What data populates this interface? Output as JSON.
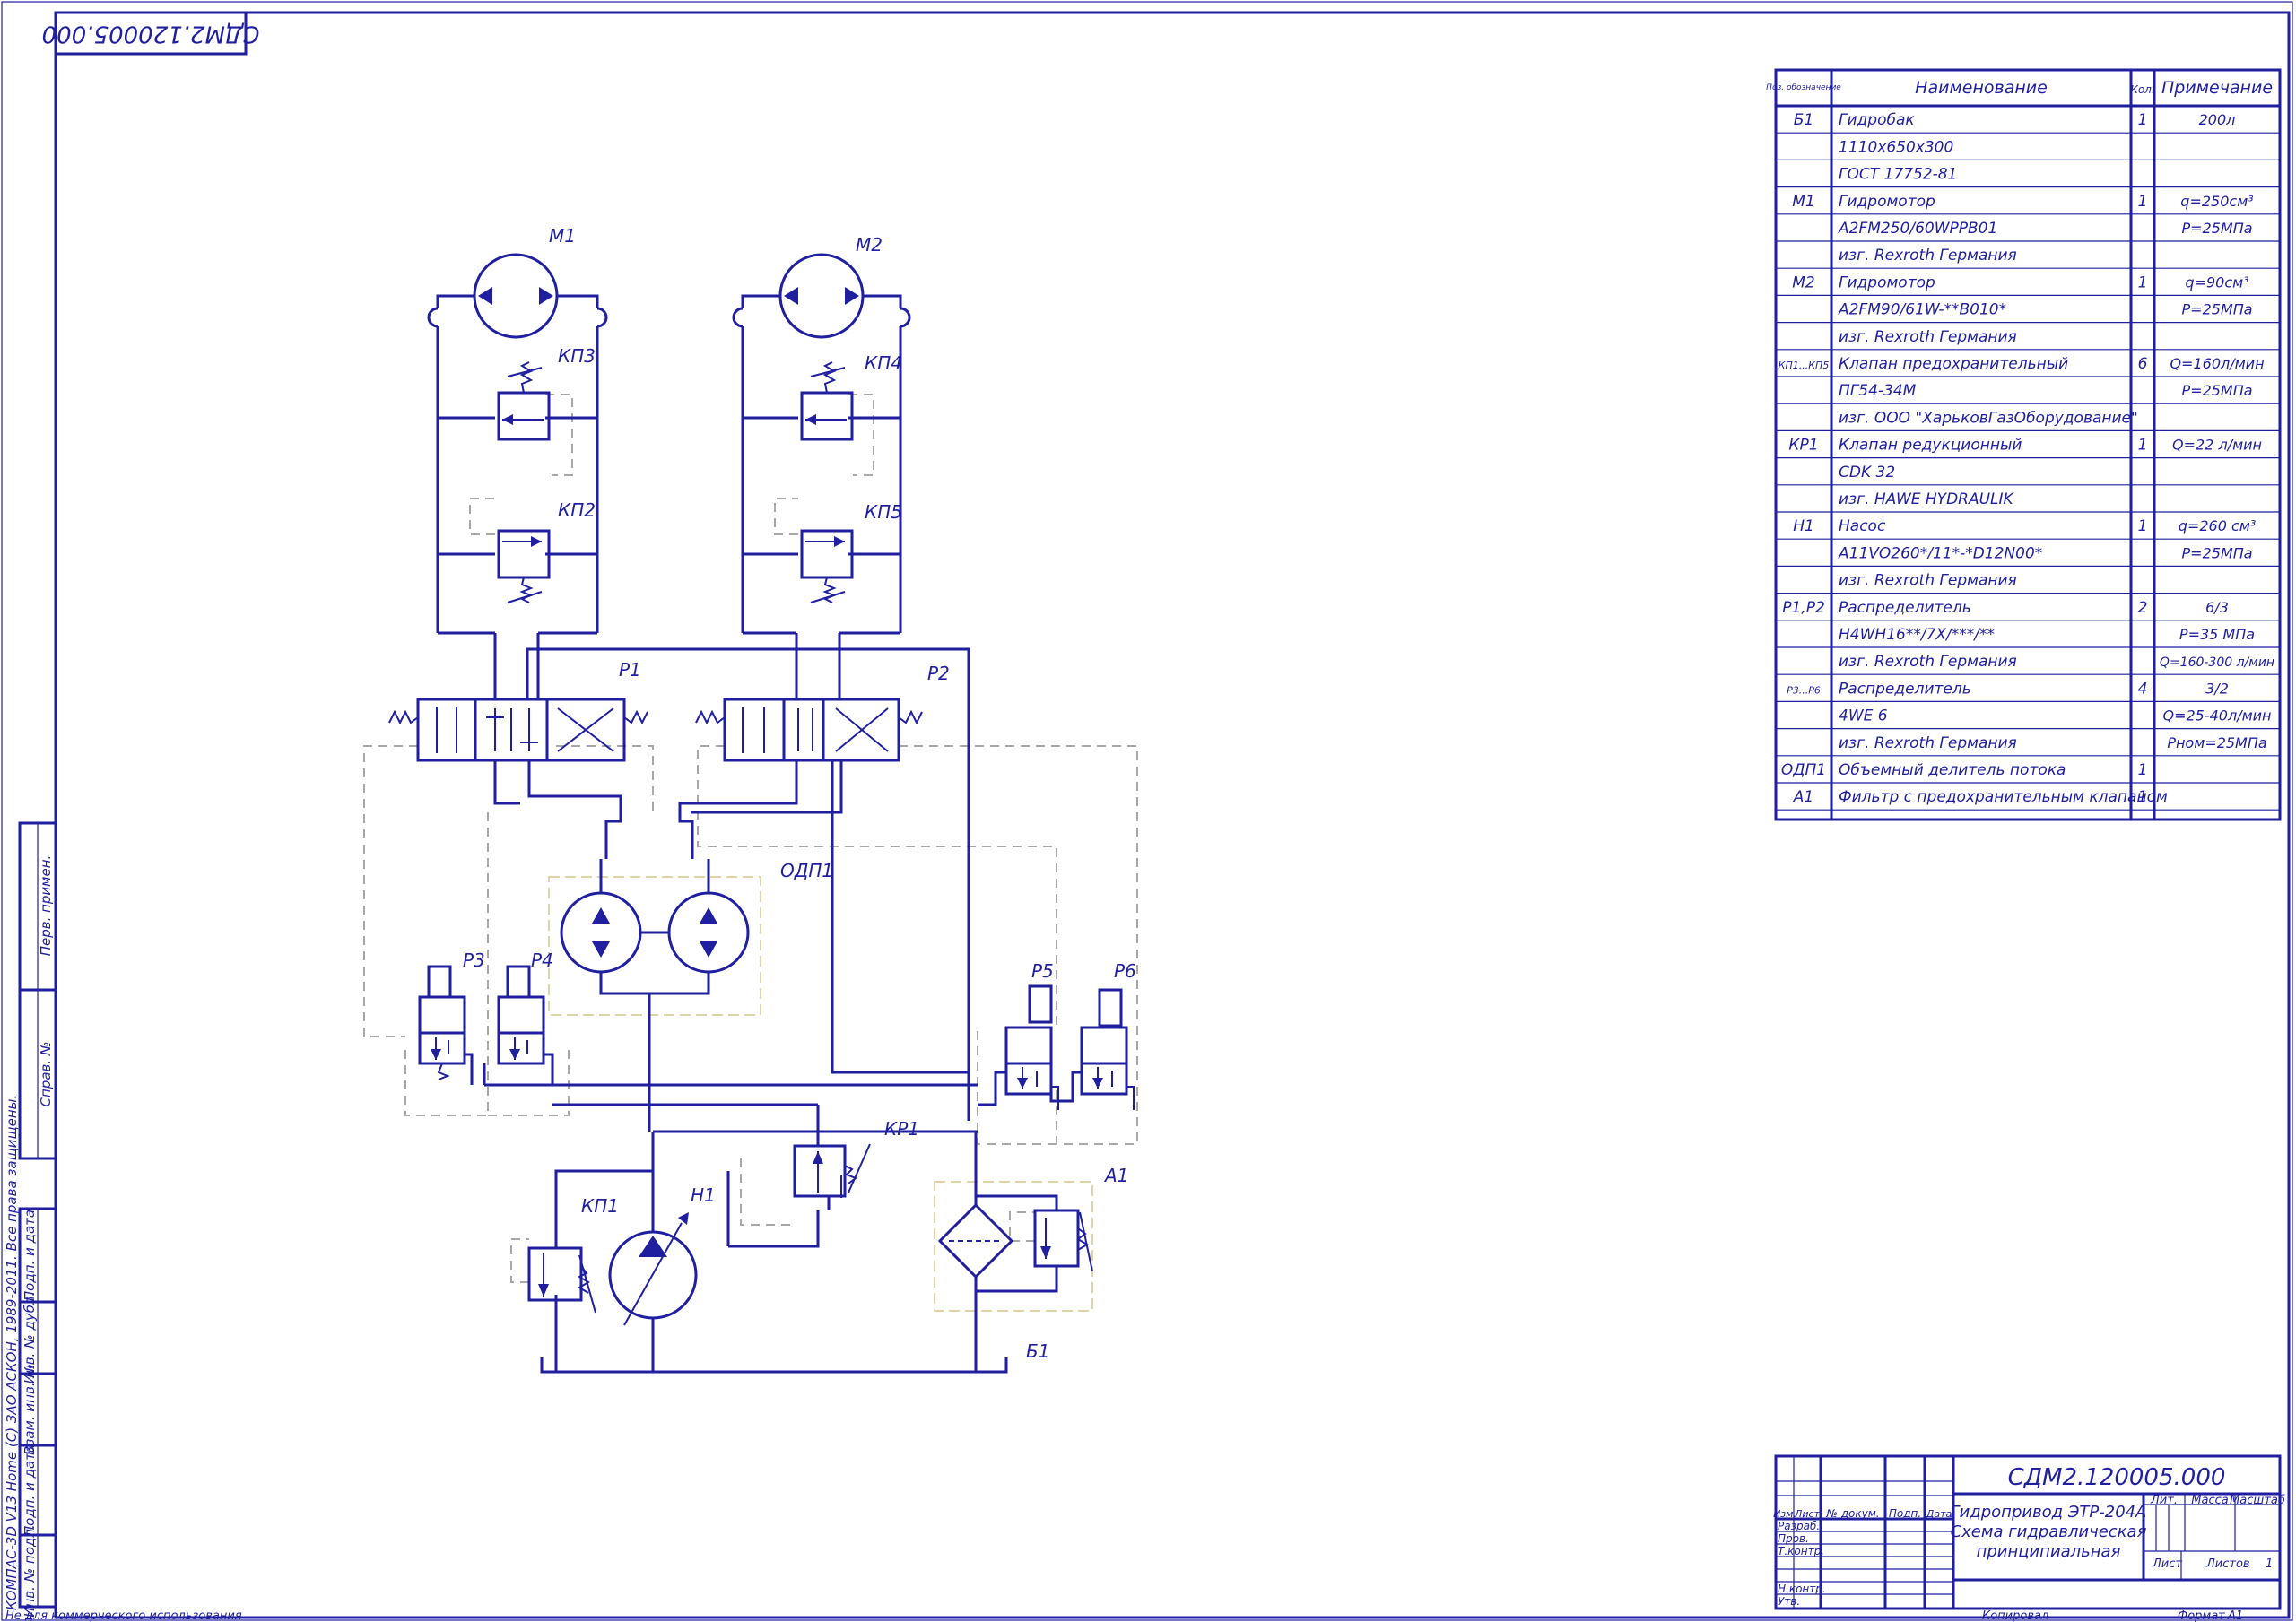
{
  "colors": {
    "ink": "#1f1fa0",
    "pilot": "#a8a8a8",
    "module_outline": "#e2d3a6",
    "paper": "#ffffff"
  },
  "corner_stamp": "СДМ2.120005.000",
  "diagram_labels": {
    "m1": "М1",
    "m2": "М2",
    "kp1": "КП1",
    "kp2": "КП2",
    "kp3": "КП3",
    "kp4": "КП4",
    "kp5": "КП5",
    "kr1": "КР1",
    "r1": "Р1",
    "r2": "Р2",
    "r3": "Р3",
    "r4": "Р4",
    "r5": "Р5",
    "r6": "Р6",
    "odp1": "ОДП1",
    "n1": "Н1",
    "a1": "А1",
    "b1": "Б1"
  },
  "parts_list": {
    "headers": {
      "pos": "Поз. обозначение",
      "name": "Наименование",
      "qty": "Кол.",
      "note": "Примечание"
    },
    "rows": [
      {
        "pos": "Б1",
        "name": "Гидробак",
        "qty": "1",
        "note": "200л"
      },
      {
        "pos": "",
        "name": "1110х650х300",
        "qty": "",
        "note": ""
      },
      {
        "pos": "",
        "name": "ГОСТ 17752-81",
        "qty": "",
        "note": ""
      },
      {
        "pos": "М1",
        "name": "Гидромотор",
        "qty": "1",
        "note": "q=250см³"
      },
      {
        "pos": "",
        "name": "A2FM250/60WPPB01",
        "qty": "",
        "note": "Р=25МПа"
      },
      {
        "pos": "",
        "name": "изг. Rexroth Германия",
        "qty": "",
        "note": ""
      },
      {
        "pos": "М2",
        "name": "Гидромотор",
        "qty": "1",
        "note": "q=90см³"
      },
      {
        "pos": "",
        "name": "A2FM90/61W-**B010*",
        "qty": "",
        "note": "Р=25МПа"
      },
      {
        "pos": "",
        "name": "изг. Rexroth Германия",
        "qty": "",
        "note": ""
      },
      {
        "pos": "КП1...КП5",
        "name": "Клапан предохранительный",
        "qty": "6",
        "note": "Q=160л/мин"
      },
      {
        "pos": "",
        "name": "ПГ54-34М",
        "qty": "",
        "note": "Р=25МПа"
      },
      {
        "pos": "",
        "name": "изг. ООО \"ХарьковГазОборудование\"",
        "qty": "",
        "note": ""
      },
      {
        "pos": "КР1",
        "name": "Клапан редукционный",
        "qty": "1",
        "note": "Q=22 л/мин"
      },
      {
        "pos": "",
        "name": "CDK 32",
        "qty": "",
        "note": ""
      },
      {
        "pos": "",
        "name": "изг. HAWE HYDRAULIK",
        "qty": "",
        "note": ""
      },
      {
        "pos": "Н1",
        "name": "Насос",
        "qty": "1",
        "note": "q=260 см³"
      },
      {
        "pos": "",
        "name": "A11VO260*/11*-*D12N00*",
        "qty": "",
        "note": "Р=25МПа"
      },
      {
        "pos": "",
        "name": "изг. Rexroth Германия",
        "qty": "",
        "note": ""
      },
      {
        "pos": "Р1,Р2",
        "name": "Распределитель",
        "qty": "2",
        "note": "6/3"
      },
      {
        "pos": "",
        "name": "H4WH16**/7X/***/**",
        "qty": "",
        "note": "Р=35 МПа"
      },
      {
        "pos": "",
        "name": "изг. Rexroth Германия",
        "qty": "",
        "note": "Q=160-300 л/мин"
      },
      {
        "pos": "Р3...Р6",
        "name": "Распределитель",
        "qty": "4",
        "note": "3/2"
      },
      {
        "pos": "",
        "name": "4WE 6",
        "qty": "",
        "note": "Q=25-40л/мин"
      },
      {
        "pos": "",
        "name": "изг. Rexroth Германия",
        "qty": "",
        "note": "Рном=25МПа"
      },
      {
        "pos": "ОДП1",
        "name": "Объемный делитель потока",
        "qty": "1",
        "note": ""
      },
      {
        "pos": "А1",
        "name": "Фильтр с предохранительным клапаном",
        "qty": "1",
        "note": ""
      }
    ]
  },
  "title_block": {
    "doc_number": "СДМ2.120005.000",
    "title_line1": "Гидропривод ЭТР-204А",
    "title_line2": "Схема гидравлическая",
    "title_line3": "принципиальная",
    "col_izm": "Изм.",
    "col_list": "Лист",
    "col_ndoc": "№ докум.",
    "col_podp": "Подп.",
    "col_data": "Дата",
    "razrab": "Разраб.",
    "prov": "Пров.",
    "tkontr": "Т.контр.",
    "nkontr": "Н.контр.",
    "utv": "Утв.",
    "lit": "Лит.",
    "massa": "Масса",
    "masshtab": "Масштаб",
    "sheet_label": "Лист",
    "sheets_label": "Листов",
    "sheets_value": "1",
    "kopiroval": "Копировал",
    "format_label": "Формат",
    "format_value": "A1"
  },
  "side_strip": {
    "perv_primen": "Перв. примен.",
    "sprav_no": "Справ. №",
    "podp_data_1": "Подп. и дата",
    "inv_dubl": "Инв. № дубл.",
    "vzam_inv": "Взам. инв. №",
    "podp_data_2": "Подп. и дата",
    "inv_podl": "Инв. № подл."
  },
  "software_note": "КОМПАС-3D V13 Home (С) ЗАО АСКОН, 1989-2011. Все права защищены.",
  "footer_note": "Не для коммерческого использования"
}
